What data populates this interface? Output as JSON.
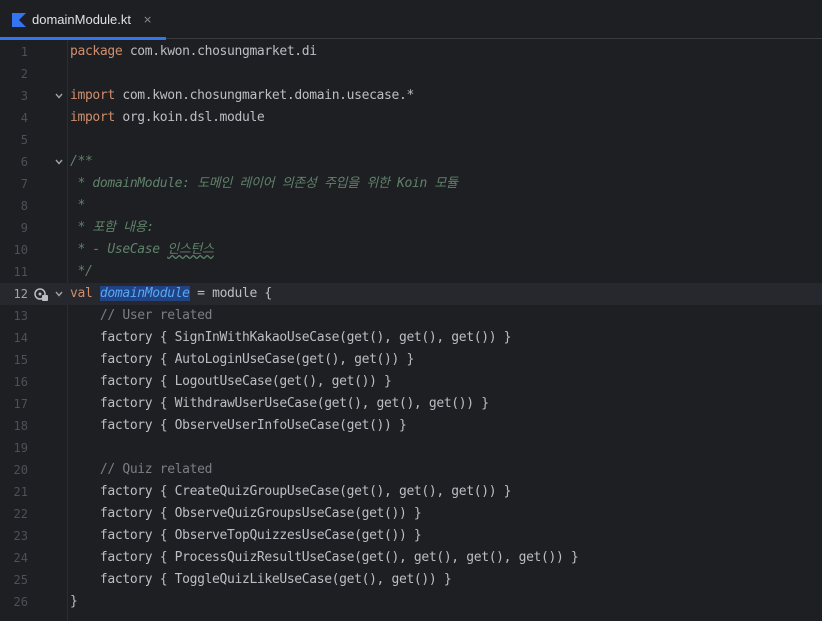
{
  "tab": {
    "filename": "domainModule.kt",
    "close_glyph": "×",
    "icon": "kotlin-file-icon"
  },
  "colors": {
    "accent": "#3574f0",
    "keyword": "#cf8e6d",
    "comment": "#7a7e85",
    "doc": "#5f826b",
    "selection": "#214283",
    "decl": "#56a8f5"
  },
  "editor": {
    "current_line": 12,
    "lines": [
      {
        "n": "1",
        "parts": [
          [
            "kw",
            "package"
          ],
          [
            "t",
            " com.kwon.chosungmarket.di"
          ]
        ]
      },
      {
        "n": "2",
        "parts": []
      },
      {
        "n": "3",
        "fold": true,
        "parts": [
          [
            "kw",
            "import"
          ],
          [
            "t",
            " com.kwon.chosungmarket.domain.usecase.*"
          ]
        ]
      },
      {
        "n": "4",
        "parts": [
          [
            "kw",
            "import"
          ],
          [
            "t",
            " org.koin.dsl.module"
          ]
        ]
      },
      {
        "n": "5",
        "parts": []
      },
      {
        "n": "6",
        "fold": true,
        "parts": [
          [
            "doc",
            "/**"
          ]
        ]
      },
      {
        "n": "7",
        "parts": [
          [
            "doc",
            " * domainModule: 도메인 레이어 의존성 주입을 위한 Koin 모듈"
          ]
        ]
      },
      {
        "n": "8",
        "parts": [
          [
            "doc",
            " *"
          ]
        ]
      },
      {
        "n": "9",
        "parts": [
          [
            "doc",
            " * 포함 내용:"
          ]
        ]
      },
      {
        "n": "10",
        "parts": [
          [
            "doc",
            " * - UseCase "
          ],
          [
            "typo",
            "인스턴스"
          ]
        ]
      },
      {
        "n": "11",
        "parts": [
          [
            "doc",
            " */"
          ]
        ]
      },
      {
        "n": "12",
        "fold": true,
        "bean": true,
        "parts": [
          [
            "kw",
            "val"
          ],
          [
            "t",
            " "
          ],
          [
            "decl",
            "domainModule"
          ],
          [
            "t",
            " = module {"
          ]
        ]
      },
      {
        "n": "13",
        "parts": [
          [
            "t",
            "    "
          ],
          [
            "cm",
            "// User related"
          ]
        ]
      },
      {
        "n": "14",
        "parts": [
          [
            "t",
            "    factory { SignInWithKakaoUseCase(get(), get(), get()) }"
          ]
        ]
      },
      {
        "n": "15",
        "parts": [
          [
            "t",
            "    factory { AutoLoginUseCase(get(), get()) }"
          ]
        ]
      },
      {
        "n": "16",
        "parts": [
          [
            "t",
            "    factory { LogoutUseCase(get(), get()) }"
          ]
        ]
      },
      {
        "n": "17",
        "parts": [
          [
            "t",
            "    factory { WithdrawUserUseCase(get(), get(), get()) }"
          ]
        ]
      },
      {
        "n": "18",
        "parts": [
          [
            "t",
            "    factory { ObserveUserInfoUseCase(get()) }"
          ]
        ]
      },
      {
        "n": "19",
        "parts": []
      },
      {
        "n": "20",
        "parts": [
          [
            "t",
            "    "
          ],
          [
            "cm",
            "// Quiz related"
          ]
        ]
      },
      {
        "n": "21",
        "parts": [
          [
            "t",
            "    factory { CreateQuizGroupUseCase(get(), get(), get()) }"
          ]
        ]
      },
      {
        "n": "22",
        "parts": [
          [
            "t",
            "    factory { ObserveQuizGroupsUseCase(get()) }"
          ]
        ]
      },
      {
        "n": "23",
        "parts": [
          [
            "t",
            "    factory { ObserveTopQuizzesUseCase(get()) }"
          ]
        ]
      },
      {
        "n": "24",
        "parts": [
          [
            "t",
            "    factory { ProcessQuizResultUseCase(get(), get(), get(), get()) }"
          ]
        ]
      },
      {
        "n": "25",
        "parts": [
          [
            "t",
            "    factory { ToggleQuizLikeUseCase(get(), get()) }"
          ]
        ]
      },
      {
        "n": "26",
        "parts": [
          [
            "t",
            "}"
          ]
        ]
      }
    ]
  }
}
